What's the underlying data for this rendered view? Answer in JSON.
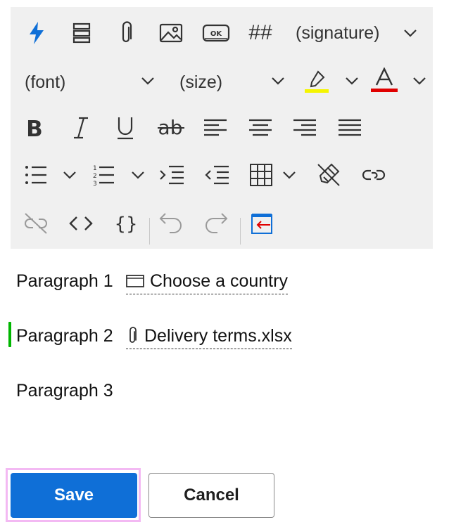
{
  "toolbar": {
    "signature_label": "(signature)",
    "font_label": "(font)",
    "size_label": "(size)",
    "ok_badge": "OK",
    "hash_label": "##",
    "highlight_color": "#f5f500",
    "font_color": "#e00000",
    "accent_icon": "#0f6fd7",
    "icons": [
      "lightning-icon",
      "stack-icon",
      "paperclip-icon",
      "image-icon",
      "ok-button-icon",
      "hash-icon",
      "highlighter-icon",
      "font-color-icon",
      "bold-icon",
      "italic-icon",
      "underline-icon",
      "strikethrough-icon",
      "align-left-icon",
      "align-center-icon",
      "align-right-icon",
      "justify-icon",
      "bullet-list-icon",
      "numbered-list-icon",
      "indent-icon",
      "outdent-icon",
      "table-icon",
      "clear-format-icon",
      "link-icon",
      "unlink-icon",
      "code-icon",
      "braces-icon",
      "undo-icon",
      "redo-icon",
      "exit-fullscreen-icon"
    ]
  },
  "content": {
    "paragraphs": [
      {
        "text": "Paragraph 1",
        "chip": "Choose a country",
        "chip_icon": "dropdown-box-icon"
      },
      {
        "text": "Paragraph 2",
        "chip": "Delivery terms.xlsx",
        "chip_icon": "paperclip-icon"
      },
      {
        "text": "Paragraph 3"
      }
    ],
    "active_marker_color": "#00b600"
  },
  "actions": {
    "save_label": "Save",
    "cancel_label": "Cancel",
    "save_color": "#0f6fd7"
  }
}
